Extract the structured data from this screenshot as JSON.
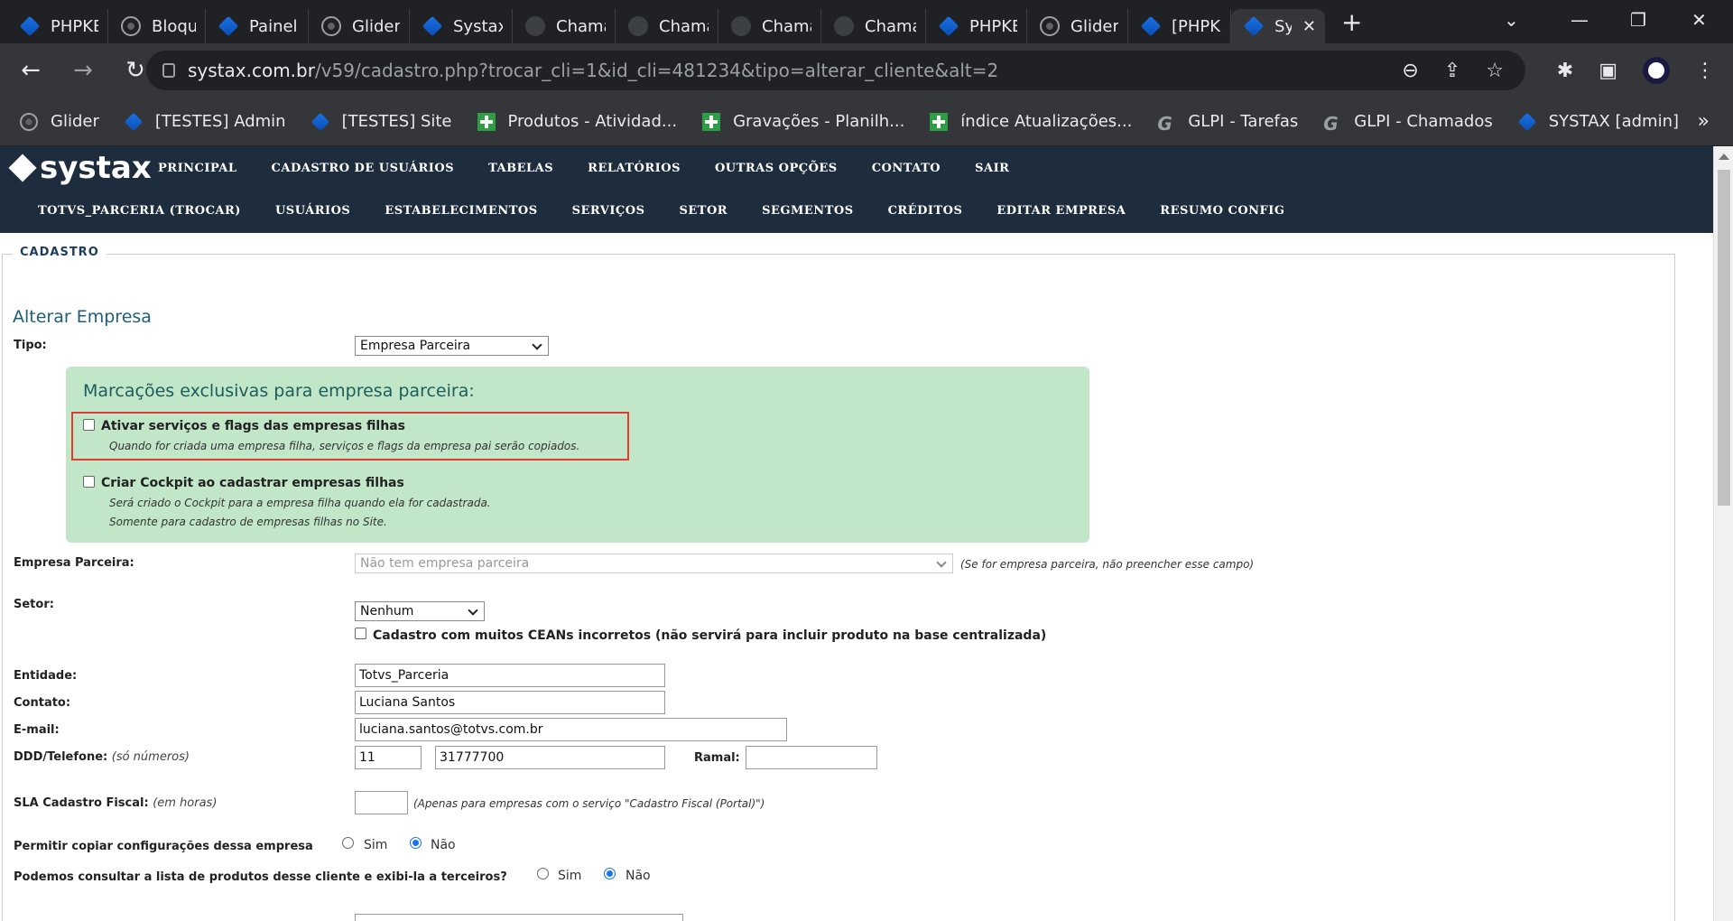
{
  "browser": {
    "tabs": [
      {
        "title": "PHPKB",
        "icon": "diamond"
      },
      {
        "title": "Bloque",
        "icon": "globe"
      },
      {
        "title": "Painel A",
        "icon": "diamond"
      },
      {
        "title": "Glider",
        "icon": "globe"
      },
      {
        "title": "Systax",
        "icon": "diamond"
      },
      {
        "title": "Chama",
        "icon": "dark"
      },
      {
        "title": "Chama",
        "icon": "dark"
      },
      {
        "title": "Chama",
        "icon": "dark"
      },
      {
        "title": "Chama",
        "icon": "dark"
      },
      {
        "title": "PHPKB",
        "icon": "diamond"
      },
      {
        "title": "Glider",
        "icon": "globe"
      },
      {
        "title": "[PHPKE",
        "icon": "diamond"
      },
      {
        "title": "Sy",
        "icon": "diamond",
        "active": true
      }
    ],
    "url_host": "systax.com.br",
    "url_path": "/v59/cadastro.php?trocar_cli=1&id_cli=481234&tipo=alterar_cliente&alt=2",
    "bookmarks": [
      {
        "label": "Glider",
        "icon": "globe"
      },
      {
        "label": "[TESTES] Admin",
        "icon": "diamond"
      },
      {
        "label": "[TESTES] Site",
        "icon": "diamond"
      },
      {
        "label": "Produtos - Atividad...",
        "icon": "green"
      },
      {
        "label": "Gravações - Planilh...",
        "icon": "green"
      },
      {
        "label": "índice Atualizações...",
        "icon": "green"
      },
      {
        "label": "GLPI - Tarefas",
        "icon": "g"
      },
      {
        "label": "GLPI - Chamados",
        "icon": "g"
      },
      {
        "label": "SYSTAX [admin]",
        "icon": "diamond"
      }
    ],
    "bookmarks_more": "»"
  },
  "site": {
    "logo": "systax",
    "menu_primary": [
      "PRINCIPAL",
      "CADASTRO DE USUÁRIOS",
      "TABELAS",
      "RELATÓRIOS",
      "OUTRAS OPÇÕES",
      "CONTATO",
      "SAIR"
    ],
    "menu_secondary": [
      "TOTVS_PARCERIA (TROCAR)",
      "USUÁRIOS",
      "ESTABELECIMENTOS",
      "SERVIÇOS",
      "SETOR",
      "SEGMENTOS",
      "CRÉDITOS",
      "EDITAR EMPRESA",
      "RESUMO CONFIG"
    ]
  },
  "form": {
    "legend": "CADASTRO",
    "title": "Alterar Empresa",
    "tipo_label": "Tipo:",
    "tipo_value": "Empresa Parceira",
    "partner_box_title": "Marcações exclusivas para empresa parceira:",
    "opt1_label": "Ativar serviços e flags das empresas filhas",
    "opt1_desc": "Quando for criada uma empresa filha, serviços e flags da empresa pai serão copiados.",
    "opt2_label": "Criar Cockpit ao cadastrar empresas filhas",
    "opt2_desc1": "Será criado o Cockpit para a empresa filha quando ela for cadastrada.",
    "opt2_desc2": "Somente para cadastro de empresas filhas no Site.",
    "parceira_label": "Empresa Parceira:",
    "parceira_value": "Não tem empresa parceira",
    "parceira_hint": "(Se for empresa parceira, não preencher esse campo)",
    "setor_label": "Setor:",
    "setor_value": "Nenhum",
    "ceans_label": "Cadastro com muitos CEANs incorretos (não servirá para incluir produto na base centralizada)",
    "entidade_label": "Entidade:",
    "entidade_value": "Totvs_Parceria",
    "contato_label": "Contato:",
    "contato_value": "Luciana Santos",
    "email_label": "E-mail:",
    "email_value": "luciana.santos@totvs.com.br",
    "phone_label": "DDD/Telefone:",
    "phone_note": "(só números)",
    "ddd_value": "11",
    "phone_value": "31777700",
    "ramal_label": "Ramal:",
    "ramal_value": "",
    "sla_label": "SLA Cadastro Fiscal:",
    "sla_note": "(em horas)",
    "sla_value": "",
    "sla_hint": "(Apenas para empresas com o serviço \"Cadastro Fiscal (Portal)\")",
    "copy_label": "Permitir copiar configurações dessa empresa",
    "consult_label": "Podemos consultar a lista de produtos desse cliente e exibi-la a terceiros?",
    "sim": "Sim",
    "nao": "Não"
  }
}
